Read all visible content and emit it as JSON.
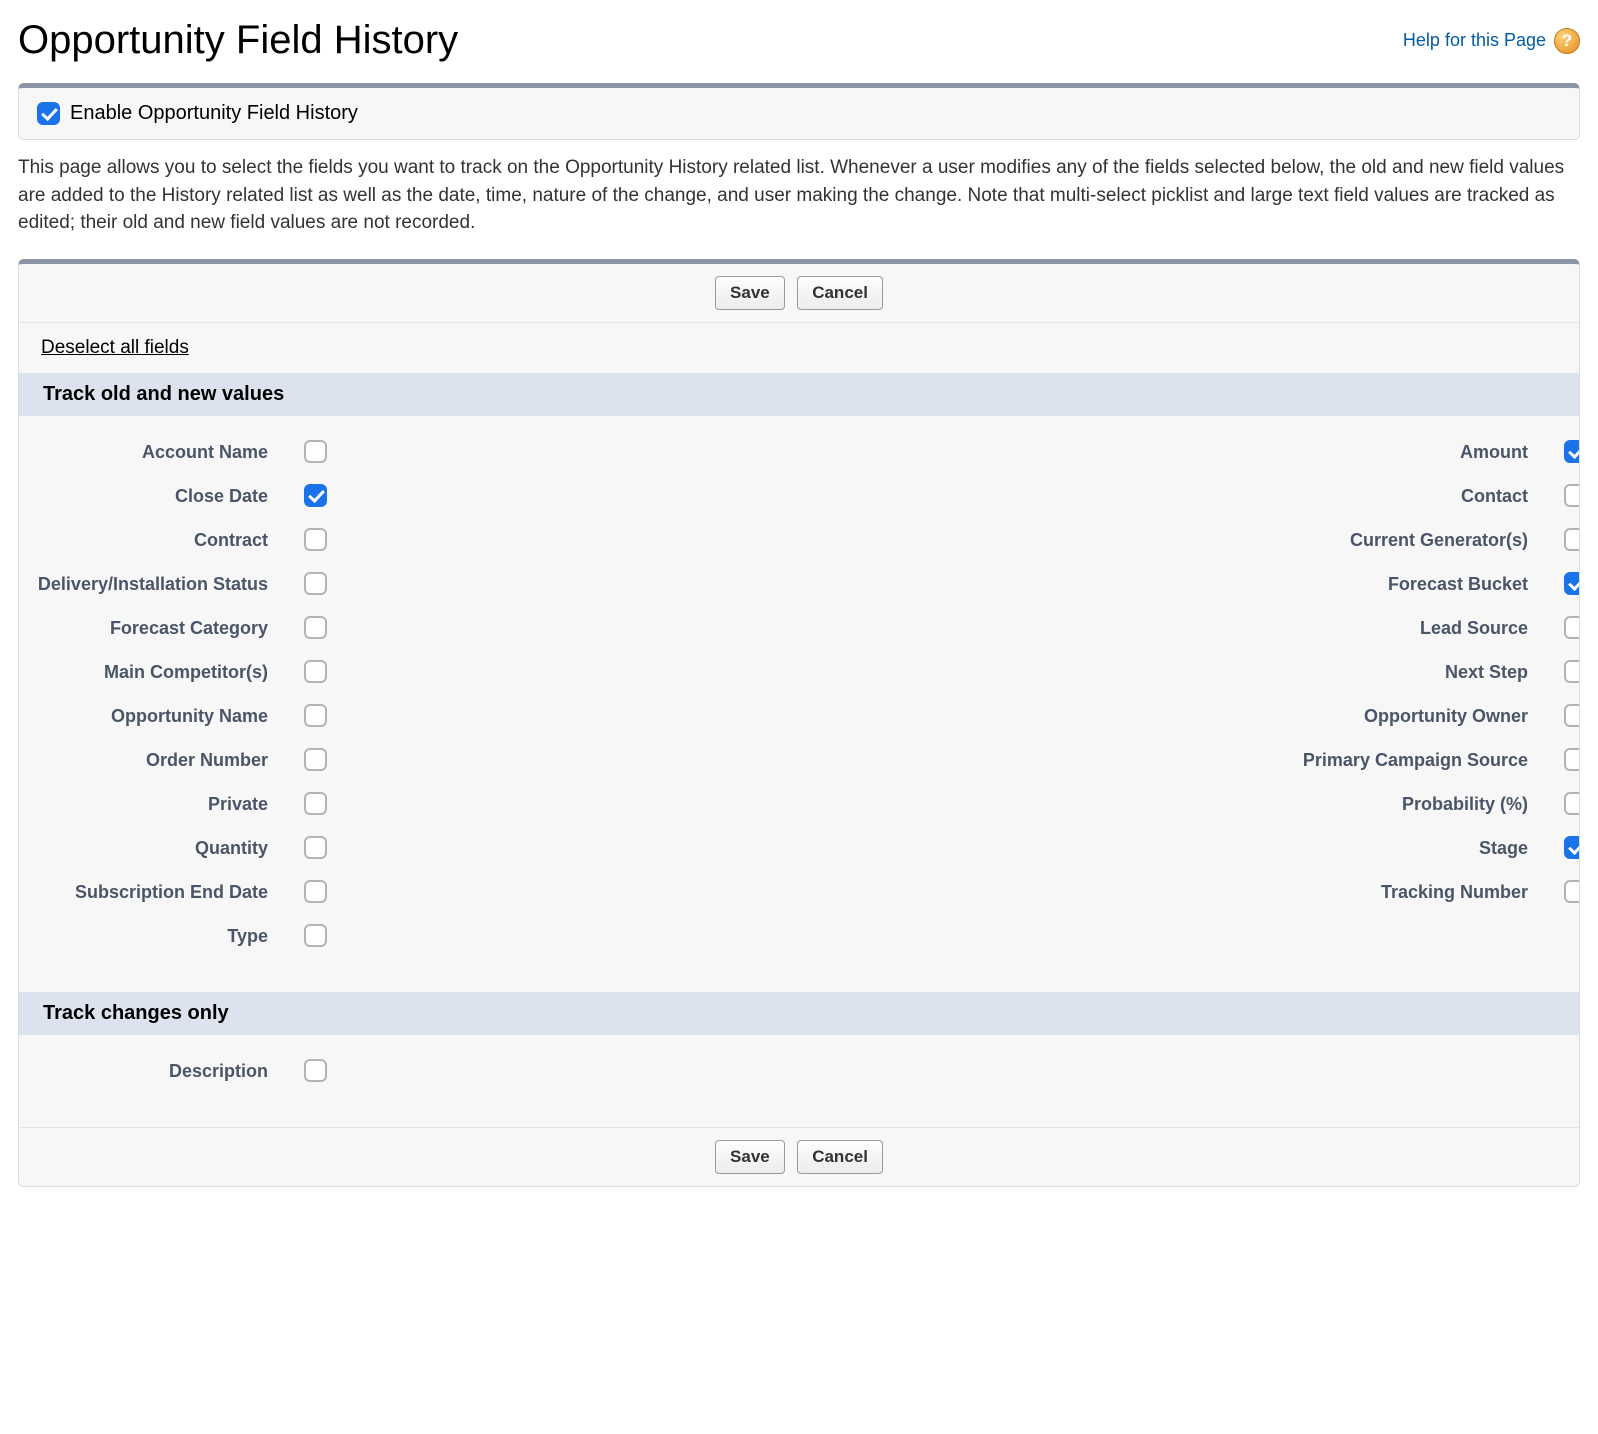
{
  "page": {
    "title": "Opportunity Field History",
    "help_label": "Help for this Page",
    "enable_label": "Enable Opportunity Field History",
    "enable_checked": true,
    "description": "This page allows you to select the fields you want to track on the Opportunity History related list. Whenever a user modifies any of the fields selected below, the old and new field values are added to the History related list as well as the date, time, nature of the change, and user making the change. Note that multi-select picklist and large text field values are tracked as edited; their old and new field values are not recorded.",
    "save_label": "Save",
    "cancel_label": "Cancel",
    "deselect_label": "Deselect all fields",
    "section_track_values": "Track old and new values",
    "section_track_changes": "Track changes only"
  },
  "fields_left": [
    {
      "label": "Account Name",
      "checked": false,
      "slug": "account-name"
    },
    {
      "label": "Close Date",
      "checked": true,
      "slug": "close-date"
    },
    {
      "label": "Contract",
      "checked": false,
      "slug": "contract"
    },
    {
      "label": "Delivery/Installation Status",
      "checked": false,
      "slug": "delivery-installation-status"
    },
    {
      "label": "Forecast Category",
      "checked": false,
      "slug": "forecast-category"
    },
    {
      "label": "Main Competitor(s)",
      "checked": false,
      "slug": "main-competitors"
    },
    {
      "label": "Opportunity Name",
      "checked": false,
      "slug": "opportunity-name"
    },
    {
      "label": "Order Number",
      "checked": false,
      "slug": "order-number"
    },
    {
      "label": "Private",
      "checked": false,
      "slug": "private"
    },
    {
      "label": "Quantity",
      "checked": false,
      "slug": "quantity"
    },
    {
      "label": "Subscription End Date",
      "checked": false,
      "slug": "subscription-end-date"
    },
    {
      "label": "Type",
      "checked": false,
      "slug": "type"
    }
  ],
  "fields_right": [
    {
      "label": "Amount",
      "checked": true,
      "slug": "amount"
    },
    {
      "label": "Contact",
      "checked": false,
      "slug": "contact"
    },
    {
      "label": "Current Generator(s)",
      "checked": false,
      "slug": "current-generators"
    },
    {
      "label": "Forecast Bucket",
      "checked": true,
      "slug": "forecast-bucket"
    },
    {
      "label": "Lead Source",
      "checked": false,
      "slug": "lead-source"
    },
    {
      "label": "Next Step",
      "checked": false,
      "slug": "next-step"
    },
    {
      "label": "Opportunity Owner",
      "checked": false,
      "slug": "opportunity-owner"
    },
    {
      "label": "Primary Campaign Source",
      "checked": false,
      "slug": "primary-campaign-source"
    },
    {
      "label": "Probability (%)",
      "checked": false,
      "slug": "probability"
    },
    {
      "label": "Stage",
      "checked": true,
      "slug": "stage"
    },
    {
      "label": "Tracking Number",
      "checked": false,
      "slug": "tracking-number"
    }
  ],
  "fields_changes_only": [
    {
      "label": "Description",
      "checked": false,
      "slug": "description"
    }
  ]
}
